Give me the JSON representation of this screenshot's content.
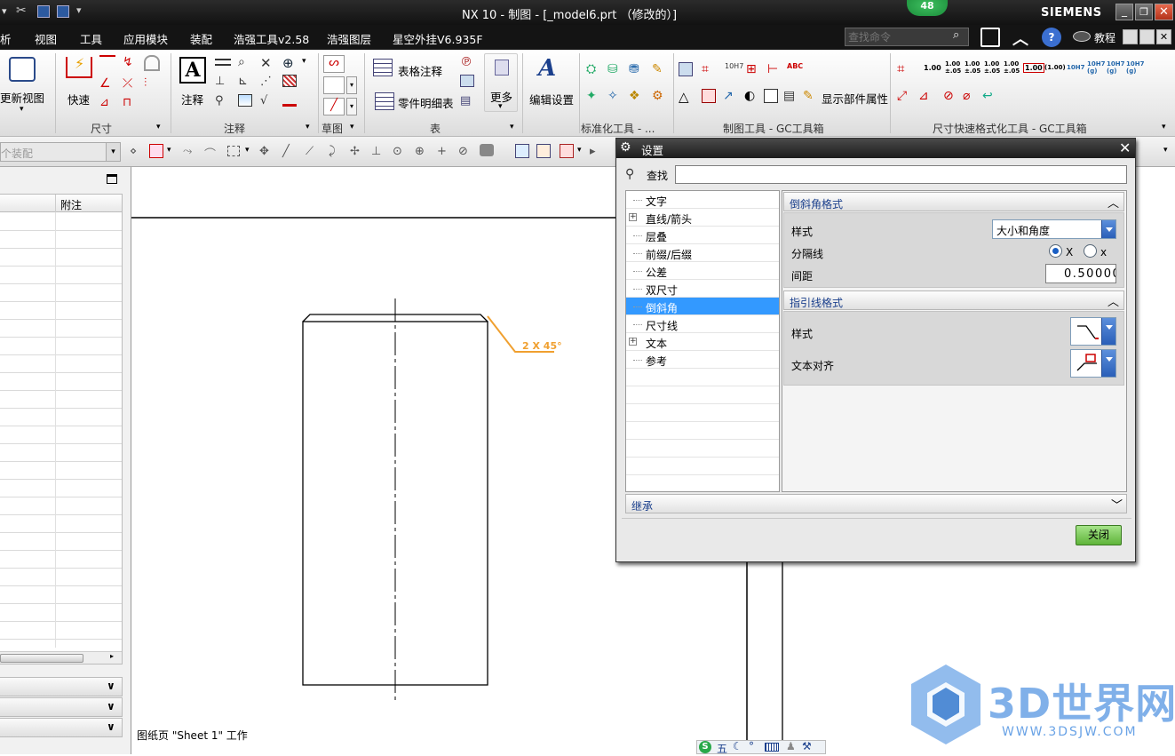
{
  "window": {
    "title": "NX 10 - 制图 - [_model6.prt （修改的）]",
    "brand": "SIEMENS",
    "badge": "48"
  },
  "menubar": {
    "items": [
      "析",
      "视图",
      "工具",
      "应用模块",
      "装配",
      "浩强工具v2.58",
      "浩强图层",
      "星空外挂V6.935F"
    ],
    "search_placeholder": "查找命令",
    "tutorial": "教程"
  },
  "ribbon": {
    "refresh_view": "更新视图",
    "quick": "快速",
    "dimension_group": "尺寸",
    "note": "注释",
    "annotation_group": "注释",
    "sketch_group": "草图",
    "table_note": "表格注释",
    "parts_list": "零件明细表",
    "more": "更多",
    "table_group": "表",
    "edit_settings": "编辑设置",
    "std_tools_group": "标准化工具 - ...",
    "show_part_attr": "显示部件属性",
    "drafting_tools_group": "制图工具 - GC工具箱",
    "dim_quick_format_group": "尺寸快速格式化工具 - GC工具箱",
    "dim_format_values": [
      "1.00",
      "1.00\n±.05",
      "1.00\n±.05",
      "1.00\n±.05",
      "1.00\n±.05",
      "1.00",
      "(1.00)",
      "10H7",
      "10H7\n(g)",
      "10H7\n(g)",
      "10H7\n(g)"
    ]
  },
  "toolbar2": {
    "assembly_filter": "个装配"
  },
  "left_panel": {
    "column_note": "附注"
  },
  "dialog": {
    "title": "设置",
    "find_label": "查找",
    "find_value": "",
    "tree": [
      {
        "label": "文字",
        "expand": false
      },
      {
        "label": "直线/箭头",
        "expand": true
      },
      {
        "label": "层叠",
        "expand": false
      },
      {
        "label": "前缀/后缀",
        "expand": false
      },
      {
        "label": "公差",
        "expand": false
      },
      {
        "label": "双尺寸",
        "expand": false
      },
      {
        "label": "倒斜角",
        "expand": false,
        "selected": true
      },
      {
        "label": "尺寸线",
        "expand": false
      },
      {
        "label": "文本",
        "expand": true
      },
      {
        "label": "参考",
        "expand": false
      }
    ],
    "chamfer_format": {
      "header": "倒斜角格式",
      "style_label": "样式",
      "style_value": "大小和角度",
      "separator_label": "分隔线",
      "sep_option_1": "X",
      "sep_option_2": "x",
      "spacing_label": "间距",
      "spacing_value": "0.50000"
    },
    "leader_format": {
      "header": "指引线格式",
      "style_label": "样式",
      "text_align_label": "文本对齐"
    },
    "inherit": "继承",
    "close_button": "关闭"
  },
  "drawing": {
    "chamfer_annotation": "2 X 45°",
    "sheet_status": "图纸页 \"Sheet 1\" 工作"
  },
  "watermark": {
    "brand": "3D世界网",
    "url": "WWW.3DSJW.COM"
  },
  "ime": {
    "mode": "五"
  },
  "colors": {
    "accent_blue": "#3399ff",
    "annotation_orange": "#f0a030",
    "dialog_button_green": "#6cc04a"
  }
}
